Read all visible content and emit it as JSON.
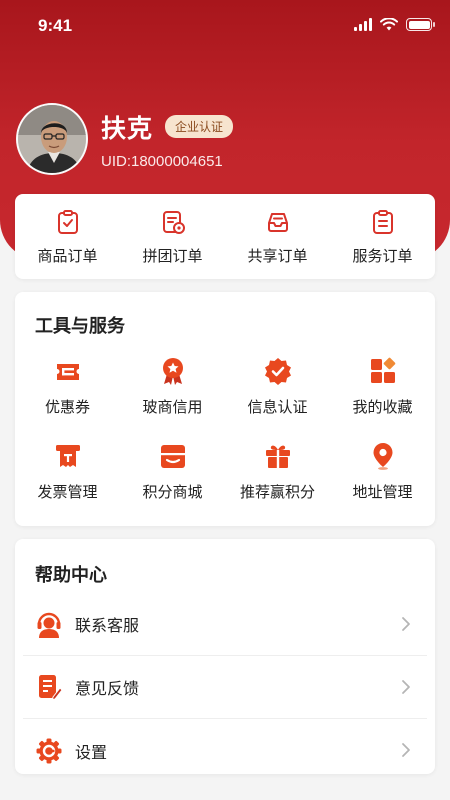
{
  "status": {
    "time": "9:41"
  },
  "profile": {
    "name": "扶克",
    "badge": "企业认证",
    "uid": "UID:18000004651"
  },
  "orders": [
    {
      "label": "商品订单",
      "icon": "clipboard-check-icon"
    },
    {
      "label": "拼团订单",
      "icon": "group-order-icon"
    },
    {
      "label": "共享订单",
      "icon": "inbox-tray-icon"
    },
    {
      "label": "服务订单",
      "icon": "clipboard-list-icon"
    }
  ],
  "tools": {
    "title": "工具与服务",
    "items": [
      {
        "label": "优惠券",
        "icon": "coupon-icon"
      },
      {
        "label": "玻商信用",
        "icon": "award-ribbon-icon"
      },
      {
        "label": "信息认证",
        "icon": "verified-seal-icon"
      },
      {
        "label": "我的收藏",
        "icon": "favorites-grid-icon"
      },
      {
        "label": "发票管理",
        "icon": "invoice-icon"
      },
      {
        "label": "积分商城",
        "icon": "store-icon"
      },
      {
        "label": "推荐赢积分",
        "icon": "gift-icon"
      },
      {
        "label": "地址管理",
        "icon": "location-pin-icon"
      }
    ]
  },
  "help": {
    "title": "帮助中心",
    "items": [
      {
        "label": "联系客服",
        "icon": "customer-service-icon"
      },
      {
        "label": "意见反馈",
        "icon": "feedback-icon"
      },
      {
        "label": "设置",
        "icon": "settings-gear-icon"
      }
    ]
  },
  "colors": {
    "brand": "#c2252b",
    "accent": "#e8481f",
    "badge_bg": "#f7e4cf"
  }
}
